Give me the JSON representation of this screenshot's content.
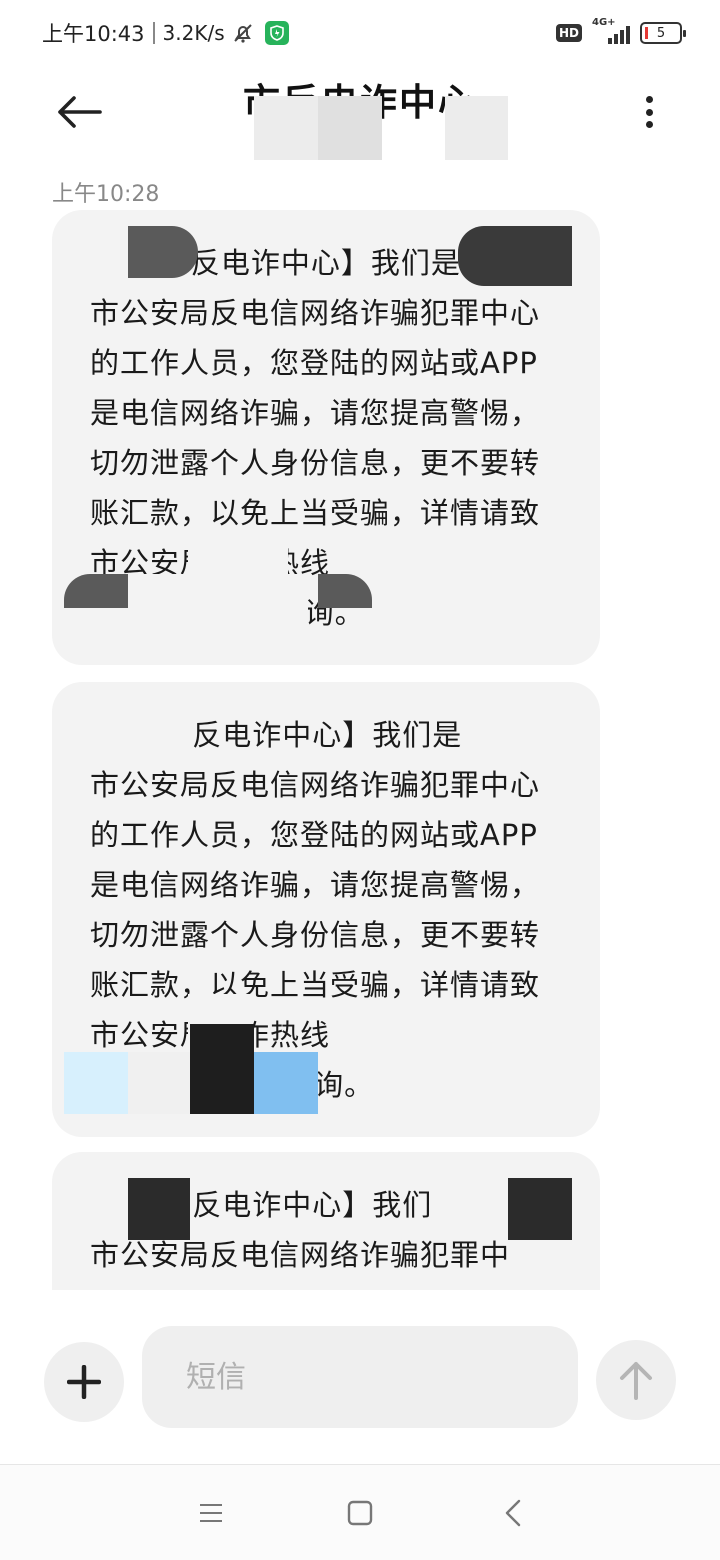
{
  "status_bar": {
    "time": "上午10:43",
    "speed": "3.2K/s",
    "hd": "HD",
    "network": "4G+",
    "battery": "5"
  },
  "header": {
    "title": "市反电诈中心",
    "back_icon": "back-arrow-icon",
    "menu_icon": "more-vertical-icon"
  },
  "conversation": {
    "timestamp": "上午10:28",
    "messages": [
      {
        "text": "【    市反电诈中心】我们是\n市公安局反电信网络诈骗犯罪中心的工作人员，您登陆的网站或APP是电信网络诈骗，请您提高警惕，切勿泄露个人身份信息，更不要转账汇款，以免上当受骗，详情请致          市公安局反诈热线\n                     询。"
      },
      {
        "text": "          反电诈中心】我们是\n市公安局反电信网络诈骗犯罪中心的工作人员，您登陆的网站或APP是电信网络诈骗，请您提高警惕，切勿泄露个人身份信息，更不要转账汇款，以免上当受骗，详情请致      市公安局反诈热线\n                   咨询。"
      },
      {
        "text": "          反电诈中心】我们\n市公安局反电信网络诈骗犯罪中\n心的工作人员，您登陆的网站或"
      }
    ]
  },
  "composer": {
    "placeholder": "短信",
    "add_icon": "plus-icon",
    "send_icon": "send-arrow-icon"
  },
  "nav_bar": {
    "items": [
      "menu-icon",
      "home-icon",
      "back-icon"
    ]
  }
}
